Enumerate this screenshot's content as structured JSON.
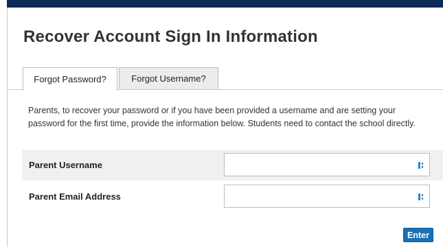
{
  "page": {
    "title": "Recover Account Sign In Information"
  },
  "tabs": [
    {
      "label": "Forgot Password?",
      "active": true
    },
    {
      "label": "Forgot Username?",
      "active": false
    }
  ],
  "intro": {
    "text": "Parents, to recover your password or if you have been provided a username and are setting your password for the first time, provide the information below. Students need to contact the school directly."
  },
  "form": {
    "fields": [
      {
        "label": "Parent Username",
        "value": "",
        "icon": "autofill-key-icon"
      },
      {
        "label": "Parent Email Address",
        "value": "",
        "icon": "autofill-key-icon"
      }
    ],
    "submit_label": "Enter"
  },
  "colors": {
    "header_bar": "#0b2a55",
    "button": "#1a6fb5",
    "row_shade": "#f0f0f0"
  }
}
